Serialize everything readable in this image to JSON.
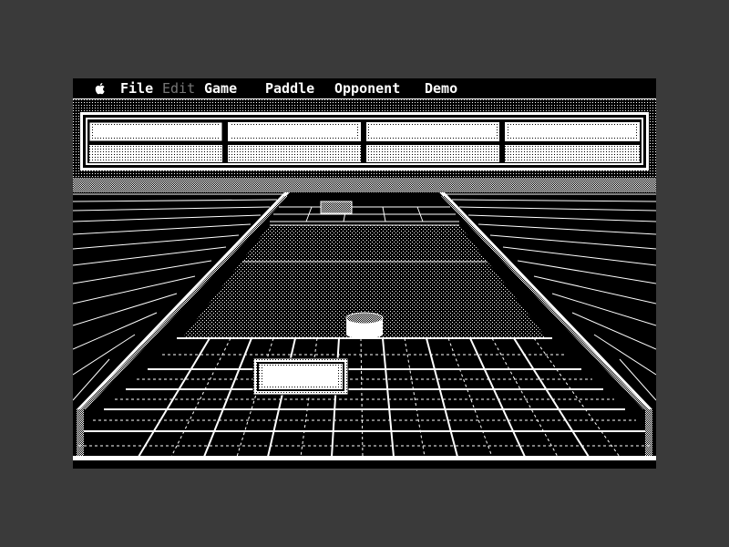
{
  "menubar": {
    "apple_icon": "apple-icon",
    "items": [
      {
        "label": "File",
        "enabled": true
      },
      {
        "label": "Edit",
        "enabled": false
      },
      {
        "label": "Game",
        "enabled": true
      },
      {
        "label": "Paddle",
        "enabled": true
      },
      {
        "label": "Opponent",
        "enabled": true
      },
      {
        "label": "Demo",
        "enabled": true
      }
    ]
  },
  "colors": {
    "background": "#3a3a3a",
    "screen": "#000000",
    "foreground": "#ffffff"
  }
}
